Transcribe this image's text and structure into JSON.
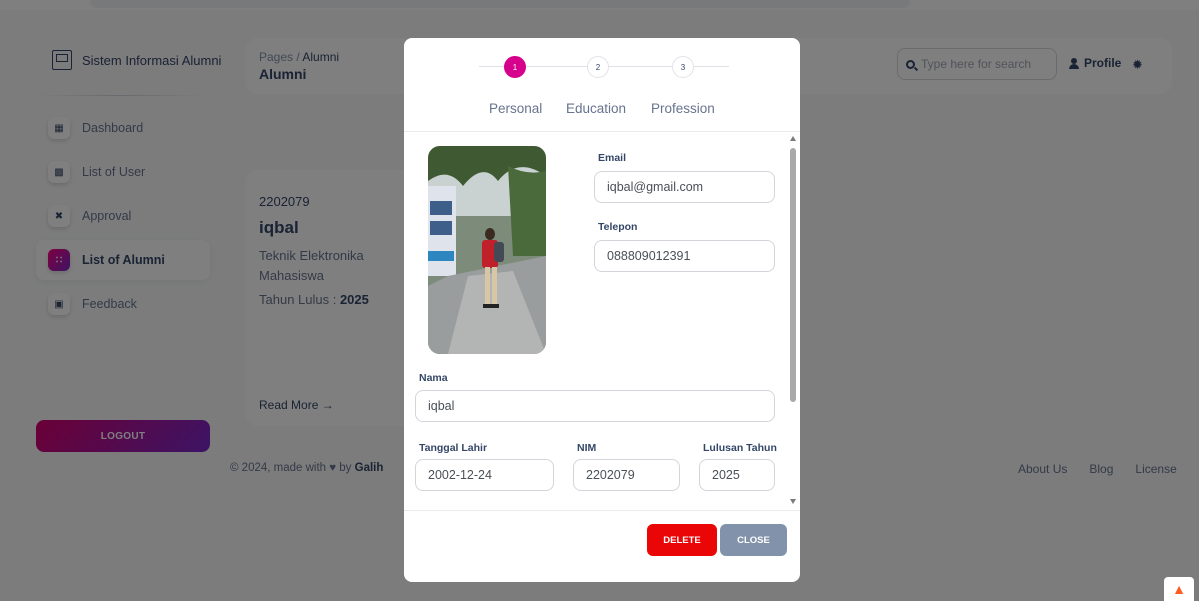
{
  "sidebar": {
    "brand": "Sistem Informasi Alumni",
    "items": [
      {
        "label": "Dashboard",
        "icon": "dashboard-icon"
      },
      {
        "label": "List of User",
        "icon": "users-icon"
      },
      {
        "label": "Approval",
        "icon": "tools-icon"
      },
      {
        "label": "List of Alumni",
        "icon": "alumni-icon",
        "active": true
      },
      {
        "label": "Feedback",
        "icon": "feedback-icon"
      }
    ],
    "logout_label": "LOGOUT"
  },
  "header": {
    "breadcrumb_root": "Pages",
    "breadcrumb_sep": "/",
    "breadcrumb_current": "Alumni",
    "title": "Alumni",
    "search_placeholder": "Type here for search",
    "profile_label": "Profile"
  },
  "card": {
    "nim": "2202079",
    "name": "iqbal",
    "major": "Teknik Elektronika",
    "status": "Mahasiswa",
    "grad_label": "Tahun Lulus : ",
    "grad_year": "2025",
    "read_more": "Read More →"
  },
  "footer": {
    "copyright_prefix": "© 2024, made with ♥ by ",
    "author": "Galih",
    "links": [
      "About Us",
      "Blog",
      "License"
    ]
  },
  "modal": {
    "steps": [
      {
        "number": "1",
        "label": "Personal",
        "active": true
      },
      {
        "number": "2",
        "label": "Education"
      },
      {
        "number": "3",
        "label": "Profession"
      }
    ],
    "fields": {
      "email": {
        "label": "Email",
        "value": "iqbal@gmail.com"
      },
      "telepon": {
        "label": "Telepon",
        "value": "088809012391"
      },
      "nama": {
        "label": "Nama",
        "value": "iqbal"
      },
      "tanggal_lahir": {
        "label": "Tanggal Lahir",
        "value": "2002-12-24"
      },
      "nim": {
        "label": "NIM",
        "value": "2202079"
      },
      "lulusan_tahun": {
        "label": "Lulusan Tahun",
        "value": "2025"
      }
    },
    "delete_label": "DELETE",
    "close_label": "CLOSE"
  },
  "colors": {
    "accent": "#d6008d",
    "danger": "#ea0606",
    "secondary": "#8392ab",
    "text": "#344767"
  }
}
